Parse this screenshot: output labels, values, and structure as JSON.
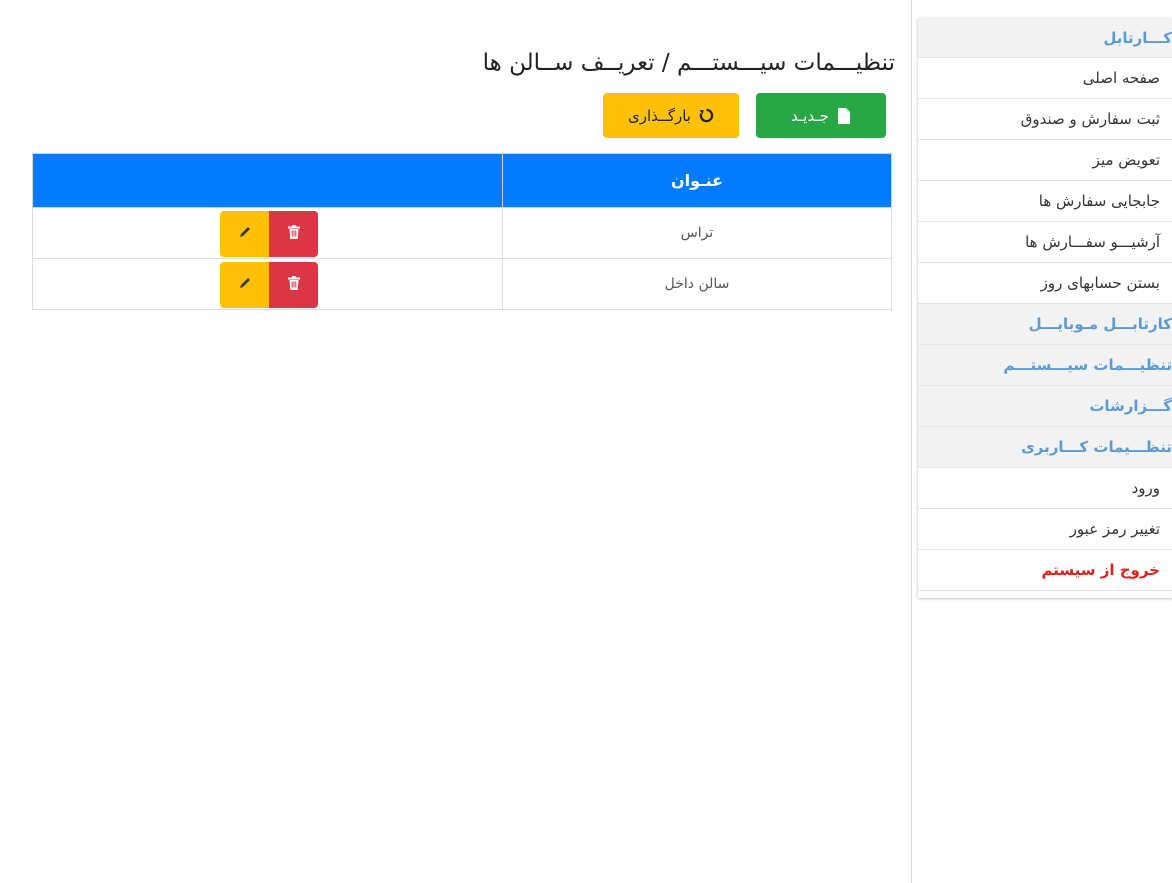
{
  "page": {
    "title": "تنظیـــمات سیـــستـــم / تعریــف ســالن ها"
  },
  "toolbar": {
    "new_label": "جـدیـد",
    "reload_label": "بارگــذاری",
    "new_color": "#28a745",
    "reload_color": "#ffc107"
  },
  "table": {
    "header": {
      "title": "عنـوان",
      "actions": ""
    },
    "header_color": "#007bff",
    "rows": [
      {
        "title": "تراس"
      },
      {
        "title": "سالن داخل"
      }
    ]
  },
  "sidebar": {
    "items": [
      {
        "label": "کـــارتابل",
        "type": "heading"
      },
      {
        "label": "صفحه اصلی",
        "type": "link"
      },
      {
        "label": "ثبت سفارش و صندوق",
        "type": "link"
      },
      {
        "label": "تعویض میز",
        "type": "link"
      },
      {
        "label": "جابجایی سفارش ها",
        "type": "link"
      },
      {
        "label": "آرشیـــو سفـــارش ها",
        "type": "link"
      },
      {
        "label": "بستن حسابهای روز",
        "type": "link"
      },
      {
        "label": "کارتابـــل مـوبایـــل",
        "type": "heading"
      },
      {
        "label": "تنظیـــمات سیـــستـــم",
        "type": "heading"
      },
      {
        "label": "گـــزارشات",
        "type": "heading"
      },
      {
        "label": "تنظـــیمات کـــاربری",
        "type": "heading"
      },
      {
        "label": "ورود",
        "type": "link"
      },
      {
        "label": "تغییر رمز عبور",
        "type": "link"
      },
      {
        "label": "خروج از سیستم",
        "type": "exit"
      }
    ],
    "heading_color": "#5b9bd5",
    "exit_color": "#e0201b"
  },
  "icons": {
    "new": "file-icon",
    "reload": "refresh-icon",
    "edit": "pencil-icon",
    "delete": "trash-icon"
  }
}
